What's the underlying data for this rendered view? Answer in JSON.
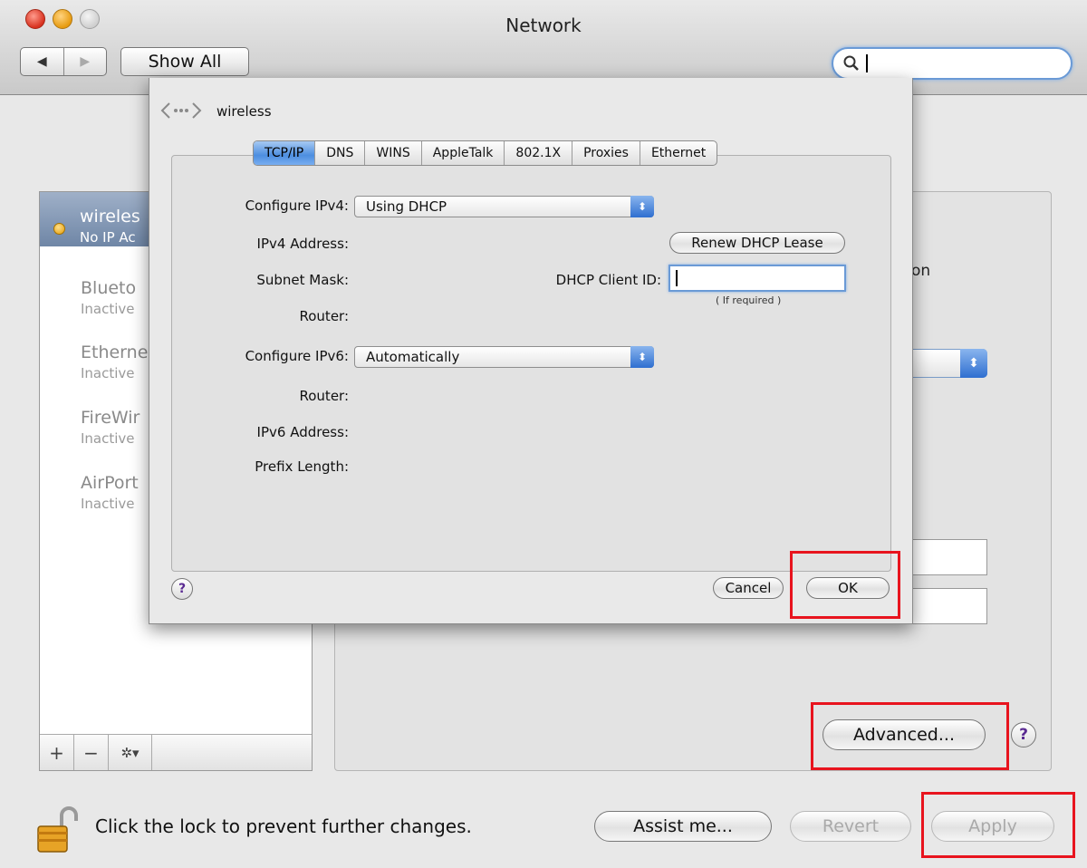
{
  "window": {
    "title": "Network"
  },
  "toolbar": {
    "back_label": "◀",
    "forward_label": "▶",
    "show_all_label": "Show All",
    "search_value": ""
  },
  "sidebar": {
    "items": [
      {
        "name": "wireles",
        "status": "No IP Ac",
        "selected": true
      },
      {
        "name": "Blueto",
        "status": "Inactive",
        "selected": false
      },
      {
        "name": "Etherne",
        "status": "Inactive",
        "selected": false
      },
      {
        "name": "FireWir",
        "status": "Inactive",
        "selected": false
      },
      {
        "name": "AirPort",
        "status": "Inactive",
        "selected": false
      }
    ],
    "add_label": "+",
    "remove_label": "−",
    "action_label": "✲▾"
  },
  "background": {
    "fragment_text": "on",
    "advanced_label": "Advanced...",
    "help_label": "?"
  },
  "footer": {
    "lock_text": "Click the lock to prevent further changes.",
    "assist_label": "Assist me...",
    "revert_label": "Revert",
    "apply_label": "Apply"
  },
  "sheet": {
    "interface_name": "wireless",
    "tabs": [
      "TCP/IP",
      "DNS",
      "WINS",
      "AppleTalk",
      "802.1X",
      "Proxies",
      "Ethernet"
    ],
    "active_tab": "TCP/IP",
    "configure_ipv4_label": "Configure IPv4:",
    "configure_ipv4_value": "Using DHCP",
    "ipv4_address_label": "IPv4 Address:",
    "subnet_mask_label": "Subnet Mask:",
    "router_label": "Router:",
    "renew_label": "Renew DHCP Lease",
    "dhcp_client_id_label": "DHCP Client ID:",
    "dhcp_client_id_value": "",
    "if_required_hint": "( If required )",
    "configure_ipv6_label": "Configure IPv6:",
    "configure_ipv6_value": "Automatically",
    "router6_label": "Router:",
    "ipv6_address_label": "IPv6 Address:",
    "prefix_length_label": "Prefix Length:",
    "help_label": "?",
    "cancel_label": "Cancel",
    "ok_label": "OK"
  },
  "colors": {
    "highlight_box": "#e8141e",
    "accent_blue": "#4d8ee0"
  }
}
